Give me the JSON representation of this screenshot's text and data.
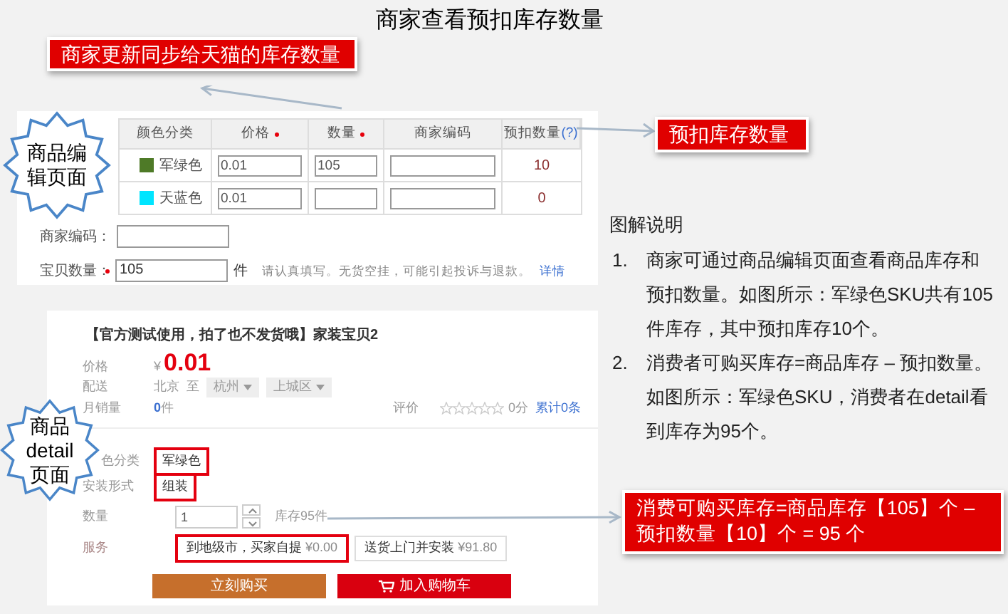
{
  "title": "商家查看预扣库存数量",
  "callouts": [
    {
      "text": "商家更新同步给天猫的库存数量"
    },
    {
      "text": "预扣库存数量"
    },
    {
      "text": "消费可购买库存=商品库存【105】个 – 预扣数量【10】个 = 95 个"
    }
  ],
  "edit_page": {
    "badge": "商品编辑页面",
    "table": {
      "columns": [
        {
          "label": "颜色分类",
          "required": false
        },
        {
          "label": "价格",
          "required": true
        },
        {
          "label": "数量",
          "required": true
        },
        {
          "label": "商家编码",
          "required": false
        },
        {
          "label": "预扣数量",
          "required": false,
          "help": "(?)"
        }
      ],
      "rows": [
        {
          "color_name": "军绿色",
          "color": "#4e7a27",
          "price": "0.01",
          "quantity": "105",
          "reserved": "10"
        },
        {
          "color_name": "天蓝色",
          "color": "#00e5ff",
          "price": "0.01",
          "reserved": "0"
        }
      ]
    },
    "merchant_code": {
      "label": "商家编码："
    },
    "item_quantity": {
      "label": "宝贝数量：",
      "required": true,
      "value": "105",
      "unit": "件",
      "hint": "请认真填写。无货空挂，可能引起投诉与退款。",
      "link": "详情"
    }
  },
  "explanation": {
    "heading": "图解说明",
    "items": [
      {
        "number": "1.",
        "text": "商家可通过商品编辑页面查看商品库存和预扣数量。如图所示：军绿色SKU共有105件库存，其中预扣库存10个。"
      },
      {
        "number": "2.",
        "text": "消费者可购买库存=商品库存 – 预扣数量。如图所示：军绿色SKU，消费者在detail看到库存为95个。"
      }
    ]
  },
  "detail_page": {
    "badge": "商品detail页面",
    "title": "【官方测试使用，拍了也不发货哦】家装宝贝2",
    "price": {
      "label": "价格",
      "currency": "¥",
      "value": "0.01"
    },
    "shipping": {
      "label": "配送",
      "from": "北京",
      "to": "至",
      "city": "杭州",
      "district": "上城区"
    },
    "sales": {
      "label": "月销量",
      "value": "0",
      "unit": "件"
    },
    "rating": {
      "label": "评价",
      "stars": 0,
      "score": "0分",
      "total": "累计0条"
    },
    "options": [
      {
        "label": "色分类",
        "value": "军绿色",
        "selected": true
      },
      {
        "label": "安装形式",
        "value": "组装",
        "selected": true
      }
    ],
    "quantity": {
      "label": "数量",
      "value": "1",
      "stock": "库存95件"
    },
    "service": {
      "label": "服务",
      "options": [
        {
          "text": "到地级市，买家自提",
          "price": "¥0.00",
          "selected": true
        },
        {
          "text": "送货上门并安装",
          "price": "¥91.80",
          "selected": false
        }
      ]
    },
    "buttons": [
      {
        "label": "立刻购买",
        "kind": "buy"
      },
      {
        "label": "加入购物车",
        "kind": "cart"
      }
    ]
  }
}
